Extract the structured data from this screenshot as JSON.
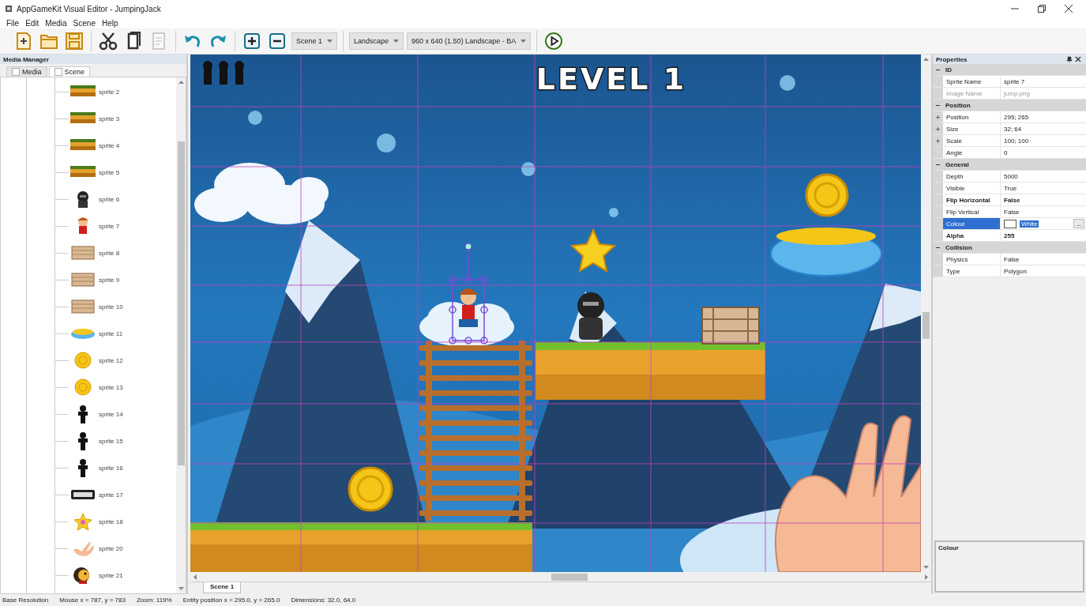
{
  "window": {
    "title": "AppGameKit Visual Editor - JumpingJack"
  },
  "menu": [
    "File",
    "Edit",
    "Media",
    "Scene",
    "Help"
  ],
  "toolbar": [
    [
      {
        "kind": "new",
        "disabled": false
      },
      {
        "kind": "open",
        "disabled": false
      },
      {
        "kind": "save",
        "disabled": false
      }
    ],
    [
      {
        "kind": "cut",
        "disabled": false
      },
      {
        "kind": "copy",
        "disabled": false
      },
      {
        "kind": "paste",
        "disabled": true
      }
    ],
    [
      {
        "kind": "undo",
        "disabled": false
      },
      {
        "kind": "redo",
        "disabled": false
      }
    ],
    [
      {
        "kind": "add",
        "disabled": false
      },
      {
        "kind": "remove",
        "disabled": false
      },
      {
        "kind": "select",
        "value": "Scene 1"
      }
    ],
    [
      {
        "kind": "select",
        "value": "Landscape"
      },
      {
        "kind": "select",
        "value": "960 x 640 (1.50) Landscape - BA"
      }
    ],
    [
      {
        "kind": "play",
        "disabled": false
      }
    ]
  ],
  "media_manager": {
    "title": "Media Manager",
    "tabs": [
      {
        "label": "Media",
        "selected": false
      },
      {
        "label": "Scene",
        "selected": true
      }
    ],
    "items": [
      {
        "label": "sprite 2",
        "kind": "ground"
      },
      {
        "label": "sprite 3",
        "kind": "ground"
      },
      {
        "label": "sprite 4",
        "kind": "ground"
      },
      {
        "label": "sprite 5",
        "kind": "ground"
      },
      {
        "label": "sprite 6",
        "kind": "knight"
      },
      {
        "label": "sprite 7",
        "kind": "boy"
      },
      {
        "label": "sprite 8",
        "kind": "crate"
      },
      {
        "label": "sprite 9",
        "kind": "crate"
      },
      {
        "label": "sprite 10",
        "kind": "crate"
      },
      {
        "label": "sprite 11",
        "kind": "cloud"
      },
      {
        "label": "sprite 12",
        "kind": "coin"
      },
      {
        "label": "sprite 13",
        "kind": "coin"
      },
      {
        "label": "sprite 14",
        "kind": "silhouette"
      },
      {
        "label": "sprite 15",
        "kind": "silhouette"
      },
      {
        "label": "sprite 16",
        "kind": "silhouette"
      },
      {
        "label": "sprite 17",
        "kind": "text"
      },
      {
        "label": "sprite 18",
        "kind": "star"
      },
      {
        "label": "sprite 20",
        "kind": "hand"
      },
      {
        "label": "sprite 21",
        "kind": "monkey"
      }
    ]
  },
  "scene": {
    "level_text": "LEVEL 1",
    "tabs": [
      {
        "label": "Scene 1",
        "selected": true
      }
    ]
  },
  "properties": {
    "title": "Properties",
    "groups": [
      {
        "name": "ID",
        "expanded": true,
        "rows": [
          {
            "name": "Sprite Name",
            "value": "sprite 7"
          },
          {
            "name": "Image Name",
            "value": "jump.png",
            "disabled": true
          }
        ]
      },
      {
        "name": "Position",
        "expanded": true,
        "rows": [
          {
            "name": "Position",
            "value": "295; 265",
            "expandable": true
          },
          {
            "name": "Size",
            "value": "32; 64",
            "expandable": true
          },
          {
            "name": "Scale",
            "value": "100; 100",
            "expandable": true
          },
          {
            "name": "Angle",
            "value": "0"
          }
        ]
      },
      {
        "name": "General",
        "expanded": true,
        "rows": [
          {
            "name": "Depth",
            "value": "5000"
          },
          {
            "name": "Visible",
            "value": "True"
          },
          {
            "name": "Flip Horizontal",
            "value": "False",
            "modified": true
          },
          {
            "name": "Flip Vertical",
            "value": "False"
          },
          {
            "name": "Colour",
            "value": "White",
            "kind": "colour",
            "selected": true,
            "button": "..."
          },
          {
            "name": "Alpha",
            "value": "255",
            "modified": true
          }
        ]
      },
      {
        "name": "Collision",
        "expanded": true,
        "rows": [
          {
            "name": "Physics",
            "value": "False"
          },
          {
            "name": "Type",
            "value": "Polygon"
          }
        ]
      }
    ],
    "help_title": "Colour"
  },
  "status_bar": [
    "Base Resolution",
    "Mouse x = 787, y = 783",
    "Zoom: 119%",
    "Entity position x = 295.0, y = 265.0",
    "Dimensions: 32.0, 64.0"
  ]
}
